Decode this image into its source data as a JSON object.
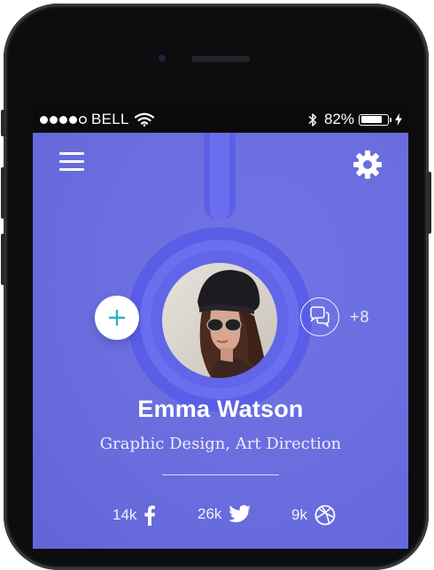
{
  "status_bar": {
    "carrier": "BELL",
    "signal_bars_filled": 4,
    "signal_bars_total": 5,
    "wifi_icon": "wifi-icon",
    "bluetooth_icon": "bluetooth-icon",
    "battery_percent": "82%",
    "battery_level": 0.82,
    "charging_icon": "bolt-icon"
  },
  "header": {
    "menu_icon": "hamburger-menu-icon",
    "settings_icon": "gear-icon"
  },
  "profile": {
    "name": "Emma Watson",
    "role": "Graphic Design, Art Direction",
    "add_icon": "plus-icon",
    "message_icon": "chat-bubbles-icon",
    "message_count": "+8"
  },
  "social": [
    {
      "count": "14k",
      "icon": "facebook-icon"
    },
    {
      "count": "26k",
      "icon": "twitter-icon"
    },
    {
      "count": "9k",
      "icon": "dribbble-icon"
    }
  ],
  "colors": {
    "background": "#6b6ee0",
    "accent": "#2ab3c8",
    "text": "#ffffff",
    "status_bar": "#0b0b0d"
  }
}
